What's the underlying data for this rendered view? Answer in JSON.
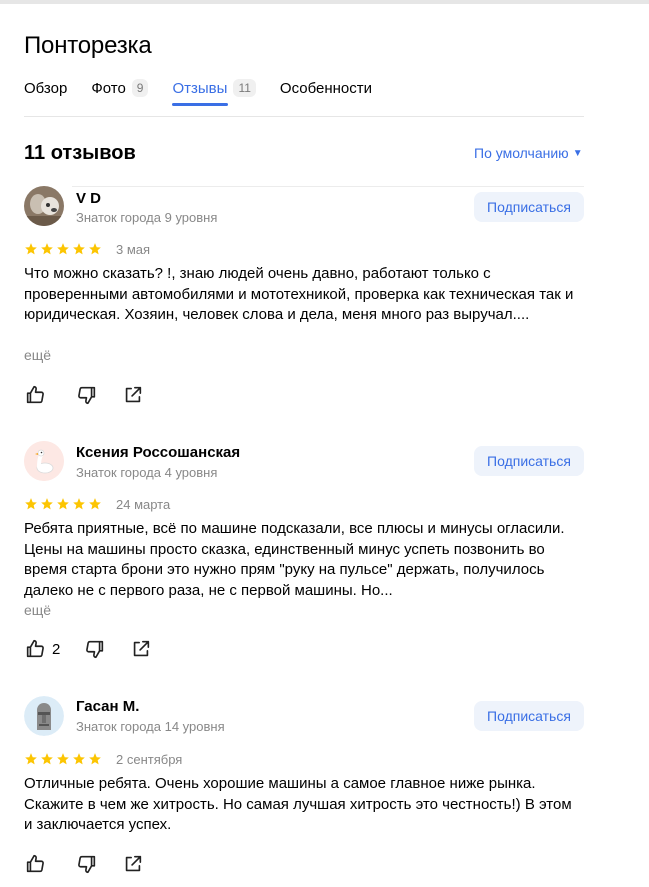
{
  "place": {
    "title": "Понторезка"
  },
  "tabs": [
    {
      "label": "Обзор",
      "count": ""
    },
    {
      "label": "Фото",
      "count": "9"
    },
    {
      "label": "Отзывы",
      "count": "11"
    },
    {
      "label": "Особенности",
      "count": ""
    }
  ],
  "reviews_header": {
    "count_title": "11 отзывов",
    "sort_label": "По умолчанию"
  },
  "reviews": [
    {
      "author": "V D",
      "level": "Знаток города 9 уровня",
      "subscribe_label": "Подписаться",
      "rating": 5,
      "date": "3 мая",
      "text": "Что можно сказать? !, знаю людей очень давно, работают только с проверенными автомобилями и мототехникой, проверка как техническая так и юридическая. Хозяин, человек слова и дела, меня много раз выручал....",
      "more_label": "ещё",
      "likes": ""
    },
    {
      "author": "Ксения Россошанская",
      "level": "Знаток города 4 уровня",
      "subscribe_label": "Подписаться",
      "rating": 5,
      "date": "24 марта",
      "text": "Ребята приятные, всё по машине подсказали, все плюсы и минусы огласили. Цены на машины просто сказка, единственный минус успеть позвонить во время старта брони это нужно прям \"руку на пульсе\" держать, получилось далеко не с первого раза, не с первой машины. Но...",
      "more_label": "ещё",
      "likes": "2"
    },
    {
      "author": "Гасан М.",
      "level": "Знаток города 14 уровня",
      "subscribe_label": "Подписаться",
      "rating": 5,
      "date": "2 сентября",
      "text": "Отличные ребята. Очень хорошие машины а самое главное ниже рынка. Скажите в чем же хитрость. Но самая лучшая хитрость это честность!) В этом и заключается успех.",
      "more_label": "",
      "likes": ""
    }
  ],
  "colors": {
    "accent": "#3a6fe5",
    "star": "#fcc502",
    "muted": "#888888",
    "subscribe_bg": "#eef3fb"
  }
}
